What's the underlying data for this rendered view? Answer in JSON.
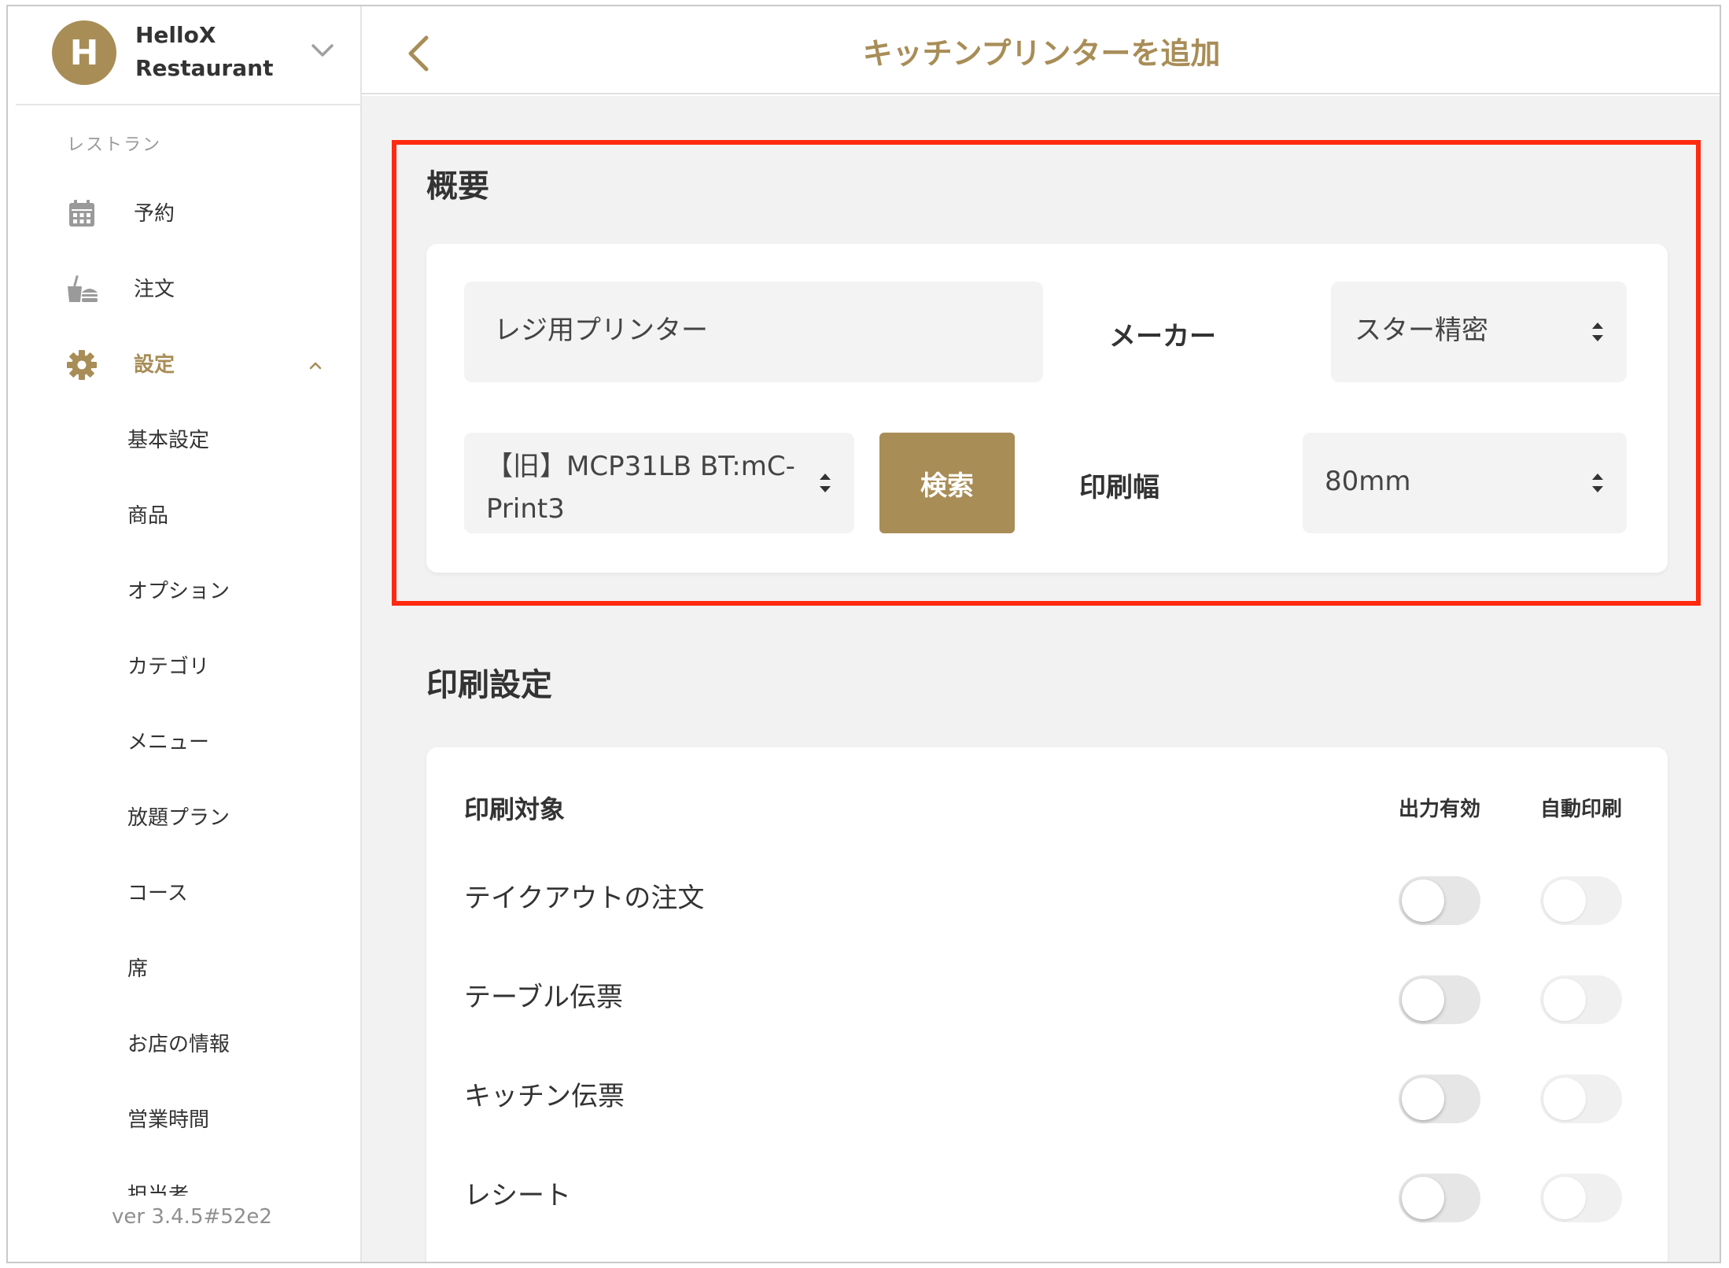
{
  "sidebar": {
    "avatar_letter": "H",
    "brand_line1": "HelloX",
    "brand_line2": "Restaurant",
    "section_label": "レストラン",
    "nav": [
      {
        "label": "予約",
        "icon": "calendar-icon"
      },
      {
        "label": "注文",
        "icon": "food-icon"
      },
      {
        "label": "設定",
        "icon": "gear-icon"
      }
    ],
    "sub_items": [
      "基本設定",
      "商品",
      "オプション",
      "カテゴリ",
      "メニュー",
      "放題プラン",
      "コース",
      "席",
      "お店の情報",
      "営業時間",
      "担当者"
    ],
    "version": "ver 3.4.5#52e2"
  },
  "header": {
    "title": "キッチンプリンターを追加"
  },
  "overview": {
    "title": "概要",
    "printer_name": "レジ用プリンター",
    "maker_label": "メーカー",
    "maker_value": "スター精密",
    "model_line1": "【旧】MCP31LB BT:mC-",
    "model_line2": "Print3",
    "search_button": "検索",
    "width_label": "印刷幅",
    "width_value": "80mm"
  },
  "print_settings": {
    "title": "印刷設定",
    "target_header": "印刷対象",
    "output_header": "出力有効",
    "auto_header": "自動印刷",
    "rows": [
      {
        "label": "テイクアウトの注文",
        "output_enabled": false,
        "auto_print": false
      },
      {
        "label": "テーブル伝票",
        "output_enabled": false,
        "auto_print": false
      },
      {
        "label": "キッチン伝票",
        "output_enabled": false,
        "auto_print": false
      },
      {
        "label": "レシート",
        "output_enabled": false,
        "auto_print": false
      }
    ]
  },
  "colors": {
    "accent": "#a88d57",
    "highlight": "#ff2a10",
    "background": "#f2f2f2"
  }
}
